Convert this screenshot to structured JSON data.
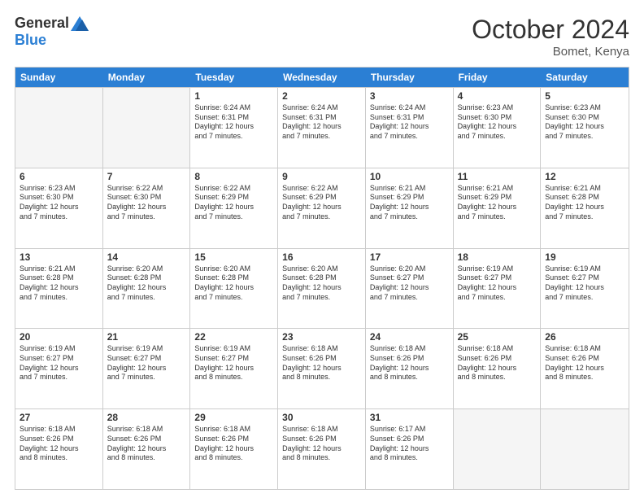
{
  "logo": {
    "general": "General",
    "blue": "Blue"
  },
  "title": "October 2024",
  "location": "Bomet, Kenya",
  "days": [
    "Sunday",
    "Monday",
    "Tuesday",
    "Wednesday",
    "Thursday",
    "Friday",
    "Saturday"
  ],
  "weeks": [
    [
      {
        "day": "",
        "info": "",
        "empty": true
      },
      {
        "day": "",
        "info": "",
        "empty": true
      },
      {
        "day": "1",
        "info": "Sunrise: 6:24 AM\nSunset: 6:31 PM\nDaylight: 12 hours\nand 7 minutes."
      },
      {
        "day": "2",
        "info": "Sunrise: 6:24 AM\nSunset: 6:31 PM\nDaylight: 12 hours\nand 7 minutes."
      },
      {
        "day": "3",
        "info": "Sunrise: 6:24 AM\nSunset: 6:31 PM\nDaylight: 12 hours\nand 7 minutes."
      },
      {
        "day": "4",
        "info": "Sunrise: 6:23 AM\nSunset: 6:30 PM\nDaylight: 12 hours\nand 7 minutes."
      },
      {
        "day": "5",
        "info": "Sunrise: 6:23 AM\nSunset: 6:30 PM\nDaylight: 12 hours\nand 7 minutes."
      }
    ],
    [
      {
        "day": "6",
        "info": "Sunrise: 6:23 AM\nSunset: 6:30 PM\nDaylight: 12 hours\nand 7 minutes."
      },
      {
        "day": "7",
        "info": "Sunrise: 6:22 AM\nSunset: 6:30 PM\nDaylight: 12 hours\nand 7 minutes."
      },
      {
        "day": "8",
        "info": "Sunrise: 6:22 AM\nSunset: 6:29 PM\nDaylight: 12 hours\nand 7 minutes."
      },
      {
        "day": "9",
        "info": "Sunrise: 6:22 AM\nSunset: 6:29 PM\nDaylight: 12 hours\nand 7 minutes."
      },
      {
        "day": "10",
        "info": "Sunrise: 6:21 AM\nSunset: 6:29 PM\nDaylight: 12 hours\nand 7 minutes."
      },
      {
        "day": "11",
        "info": "Sunrise: 6:21 AM\nSunset: 6:29 PM\nDaylight: 12 hours\nand 7 minutes."
      },
      {
        "day": "12",
        "info": "Sunrise: 6:21 AM\nSunset: 6:28 PM\nDaylight: 12 hours\nand 7 minutes."
      }
    ],
    [
      {
        "day": "13",
        "info": "Sunrise: 6:21 AM\nSunset: 6:28 PM\nDaylight: 12 hours\nand 7 minutes."
      },
      {
        "day": "14",
        "info": "Sunrise: 6:20 AM\nSunset: 6:28 PM\nDaylight: 12 hours\nand 7 minutes."
      },
      {
        "day": "15",
        "info": "Sunrise: 6:20 AM\nSunset: 6:28 PM\nDaylight: 12 hours\nand 7 minutes."
      },
      {
        "day": "16",
        "info": "Sunrise: 6:20 AM\nSunset: 6:28 PM\nDaylight: 12 hours\nand 7 minutes."
      },
      {
        "day": "17",
        "info": "Sunrise: 6:20 AM\nSunset: 6:27 PM\nDaylight: 12 hours\nand 7 minutes."
      },
      {
        "day": "18",
        "info": "Sunrise: 6:19 AM\nSunset: 6:27 PM\nDaylight: 12 hours\nand 7 minutes."
      },
      {
        "day": "19",
        "info": "Sunrise: 6:19 AM\nSunset: 6:27 PM\nDaylight: 12 hours\nand 7 minutes."
      }
    ],
    [
      {
        "day": "20",
        "info": "Sunrise: 6:19 AM\nSunset: 6:27 PM\nDaylight: 12 hours\nand 7 minutes."
      },
      {
        "day": "21",
        "info": "Sunrise: 6:19 AM\nSunset: 6:27 PM\nDaylight: 12 hours\nand 7 minutes."
      },
      {
        "day": "22",
        "info": "Sunrise: 6:19 AM\nSunset: 6:27 PM\nDaylight: 12 hours\nand 8 minutes."
      },
      {
        "day": "23",
        "info": "Sunrise: 6:18 AM\nSunset: 6:26 PM\nDaylight: 12 hours\nand 8 minutes."
      },
      {
        "day": "24",
        "info": "Sunrise: 6:18 AM\nSunset: 6:26 PM\nDaylight: 12 hours\nand 8 minutes."
      },
      {
        "day": "25",
        "info": "Sunrise: 6:18 AM\nSunset: 6:26 PM\nDaylight: 12 hours\nand 8 minutes."
      },
      {
        "day": "26",
        "info": "Sunrise: 6:18 AM\nSunset: 6:26 PM\nDaylight: 12 hours\nand 8 minutes."
      }
    ],
    [
      {
        "day": "27",
        "info": "Sunrise: 6:18 AM\nSunset: 6:26 PM\nDaylight: 12 hours\nand 8 minutes."
      },
      {
        "day": "28",
        "info": "Sunrise: 6:18 AM\nSunset: 6:26 PM\nDaylight: 12 hours\nand 8 minutes."
      },
      {
        "day": "29",
        "info": "Sunrise: 6:18 AM\nSunset: 6:26 PM\nDaylight: 12 hours\nand 8 minutes."
      },
      {
        "day": "30",
        "info": "Sunrise: 6:18 AM\nSunset: 6:26 PM\nDaylight: 12 hours\nand 8 minutes."
      },
      {
        "day": "31",
        "info": "Sunrise: 6:17 AM\nSunset: 6:26 PM\nDaylight: 12 hours\nand 8 minutes."
      },
      {
        "day": "",
        "info": "",
        "empty": true
      },
      {
        "day": "",
        "info": "",
        "empty": true
      }
    ]
  ]
}
